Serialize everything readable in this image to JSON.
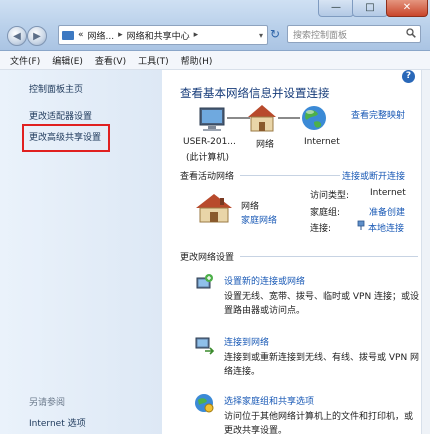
{
  "window": {
    "min_glyph": "—",
    "max_glyph": "□",
    "close_glyph": "✕"
  },
  "address_bar": {
    "back_glyph": "◀",
    "forward_glyph": "▶",
    "prefix": "«",
    "crumb1": "网络...",
    "separator": "▸",
    "crumb2": "网络和共享中心",
    "dropdown_glyph": "▾",
    "refresh_glyph": "↻"
  },
  "search": {
    "placeholder": "搜索控制面板"
  },
  "menu": [
    "文件(F)",
    "编辑(E)",
    "查看(V)",
    "工具(T)",
    "帮助(H)"
  ],
  "left_pane": {
    "home": "控制面板主页",
    "adapter": "更改适配器设置",
    "advanced_sharing": "更改高级共享设置",
    "see_also": "另请参阅",
    "internet_options": "Internet 选项"
  },
  "main": {
    "help_glyph": "?",
    "title": "查看基本网络信息并设置连接",
    "full_map_link": "查看完整映射",
    "map": {
      "computer_name": "USER-201...",
      "computer_sub": "(此计算机)",
      "network": "网络",
      "internet": "Internet"
    },
    "active_networks": {
      "header": "查看活动网络",
      "connect_link": "连接或断开连接",
      "network_name": "网络",
      "network_type": "家庭网络",
      "access_type_label": "访问类型:",
      "access_type_value": "Internet",
      "homegroup_label": "家庭组:",
      "homegroup_value": "准备创建",
      "connection_label": "连接:",
      "connection_value": "本地连接"
    },
    "change_settings": {
      "header": "更改网络设置",
      "tasks": [
        {
          "title": "设置新的连接或网络",
          "desc": "设置无线、宽带、拨号、临时或 VPN 连接；或设置路由器或访问点。"
        },
        {
          "title": "连接到网络",
          "desc": "连接到或重新连接到无线、有线、拨号或 VPN 网络连接。"
        },
        {
          "title": "选择家庭组和共享选项",
          "desc": "访问位于其他网络计算机上的文件和打印机，或更改共享设置。"
        }
      ]
    }
  },
  "colors": {
    "link": "#1a5ab6",
    "title": "#173c7a",
    "highlight": "#e02020",
    "homegroup_value": "#1a5ab6"
  }
}
